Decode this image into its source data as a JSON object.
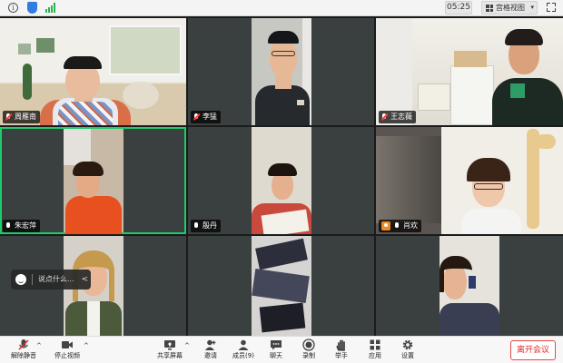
{
  "topbar": {
    "time": "05:25",
    "view_label": "宫格视图",
    "caret": "▾"
  },
  "participants": [
    {
      "name": "周雁南",
      "muted": true
    },
    {
      "name": "李猛",
      "muted": true
    },
    {
      "name": "王志薇",
      "muted": true
    },
    {
      "name": "朱宏萍",
      "muted": false
    },
    {
      "name": "殷丹",
      "muted": false
    },
    {
      "name": "肖欢",
      "muted": false,
      "host": true
    }
  ],
  "chat_placeholder": "说点什么...",
  "chat_arrow": "<",
  "toolbar": {
    "mute_label": "解除静音",
    "video_label": "停止视频",
    "share_label": "共享屏幕",
    "invite_label": "邀请",
    "members_label": "成员(9)",
    "chat_label": "聊天",
    "record_label": "录制",
    "raise_hand_label": "举手",
    "apps_label": "应用",
    "settings_label": "设置",
    "leave_label": "离开会议",
    "caret": "^"
  },
  "colors": {
    "active_border": "#1fcc6b",
    "leave_red": "#e02b2b",
    "tile_bg": "#3a3f3f"
  }
}
